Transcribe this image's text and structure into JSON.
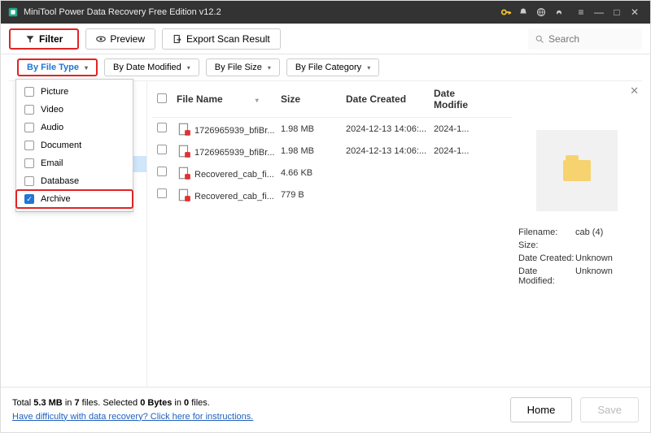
{
  "title": "MiniTool Power Data Recovery Free Edition v12.2",
  "toolbar": {
    "filter": "Filter",
    "preview": "Preview",
    "export": "Export Scan Result",
    "search_placeholder": "Search"
  },
  "filterbar": {
    "byType": "By File Type",
    "byDate": "By Date Modified",
    "bySize": "By File Size",
    "byCat": "By File Category"
  },
  "typeDropdown": [
    {
      "label": "Picture",
      "checked": false
    },
    {
      "label": "Video",
      "checked": false
    },
    {
      "label": "Audio",
      "checked": false
    },
    {
      "label": "Document",
      "checked": false
    },
    {
      "label": "Email",
      "checked": false
    },
    {
      "label": "Database",
      "checked": false
    },
    {
      "label": "Archive",
      "checked": true,
      "hl": true
    }
  ],
  "columns": {
    "name": "File Name",
    "size": "Size",
    "dc": "Date Created",
    "dm": "Date Modifie"
  },
  "rows": [
    {
      "name": "1726965939_bfiBr...",
      "size": "1.98 MB",
      "dc": "2024-12-13 14:06:...",
      "dm": "2024-1..."
    },
    {
      "name": "1726965939_bfiBr...",
      "size": "1.98 MB",
      "dc": "2024-12-13 14:06:...",
      "dm": "2024-1..."
    },
    {
      "name": "Recovered_cab_fi...",
      "size": "4.66 KB",
      "dc": "",
      "dm": ""
    },
    {
      "name": "Recovered_cab_fi...",
      "size": "779 B",
      "dc": "",
      "dm": ""
    }
  ],
  "detail": {
    "filename_k": "Filename:",
    "filename_v": "cab (4)",
    "size_k": "Size:",
    "size_v": "",
    "dc_k": "Date Created:",
    "dc_v": "Unknown",
    "dm_k": "Date Modified:",
    "dm_v": "Unknown"
  },
  "footer": {
    "total_pre": "Total ",
    "total_size": "5.3 MB",
    "total_mid": " in ",
    "total_files": "7",
    "total_post": " files.",
    "selected_pre": "  Selected ",
    "selected_bytes": "0 Bytes",
    "selected_mid": " in ",
    "selected_files": "0",
    "selected_post": " files.",
    "help": "Have difficulty with data recovery? Click here for instructions.",
    "home": "Home",
    "save": "Save"
  }
}
